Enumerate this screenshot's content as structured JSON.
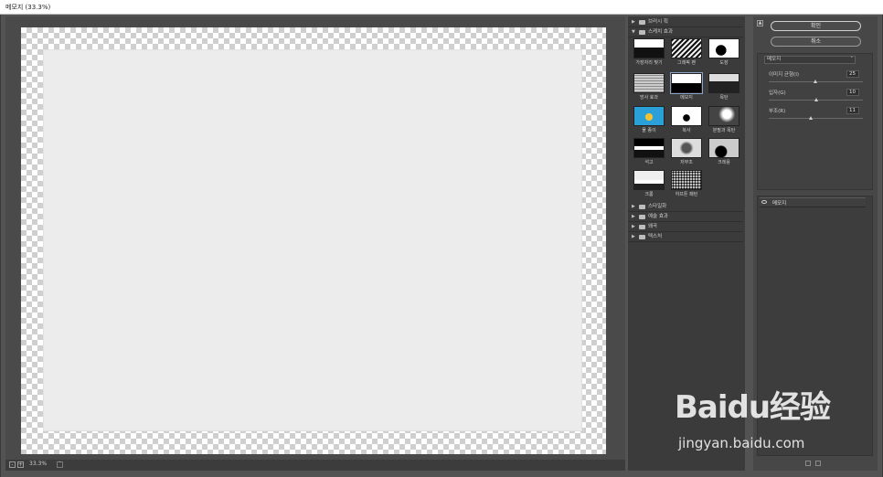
{
  "window": {
    "title": "메모지 (33.3%)"
  },
  "status": {
    "zoom": "33.3%",
    "zoom_out": "-",
    "zoom_in": "+",
    "dropdown": "˅"
  },
  "gallery": {
    "categories_top": [
      {
        "name": "브러시 획",
        "expanded": false,
        "arrow": "▶"
      },
      {
        "name": "스케치 효과",
        "expanded": true,
        "arrow": "▼"
      }
    ],
    "thumbnails": [
      {
        "label": "가장자리 찢기",
        "selected": false
      },
      {
        "label": "그래픽 펜",
        "selected": false
      },
      {
        "label": "도장",
        "selected": false
      },
      {
        "label": "망사 효과",
        "selected": false
      },
      {
        "label": "메모지",
        "selected": true
      },
      {
        "label": "목탄",
        "selected": false
      },
      {
        "label": "물 종이",
        "selected": false
      },
      {
        "label": "복사",
        "selected": false
      },
      {
        "label": "분필과 목탄",
        "selected": false
      },
      {
        "label": "석고",
        "selected": false
      },
      {
        "label": "저부조",
        "selected": false
      },
      {
        "label": "크레용",
        "selected": false
      },
      {
        "label": "크롬",
        "selected": false
      },
      {
        "label": "하프톤 패턴",
        "selected": false
      }
    ],
    "categories_bottom": [
      {
        "name": "스타일화",
        "arrow": "▶"
      },
      {
        "name": "예술 효과",
        "arrow": "▶"
      },
      {
        "name": "왜곡",
        "arrow": "▶"
      },
      {
        "name": "텍스처",
        "arrow": "▶"
      }
    ]
  },
  "panel": {
    "collapse_icon": "▲",
    "ok_label": "확인",
    "cancel_label": "취소",
    "filter_select": "메모지",
    "select_arrow": "˅",
    "params": [
      {
        "label": "이미지 균형(I)",
        "value": "25",
        "max": 50
      },
      {
        "label": "입자(G)",
        "value": "10",
        "max": 20
      },
      {
        "label": "부조(R)",
        "value": "11",
        "max": 25
      }
    ],
    "layers": [
      {
        "name": "메모지"
      }
    ]
  },
  "watermark": {
    "logo": "Baidu经验",
    "url": "jingyan.baidu.com"
  },
  "colors": {
    "bg": "#535353",
    "panel": "#474747",
    "gallery": "#3b3b3b",
    "accent": "#8aa3c6"
  }
}
